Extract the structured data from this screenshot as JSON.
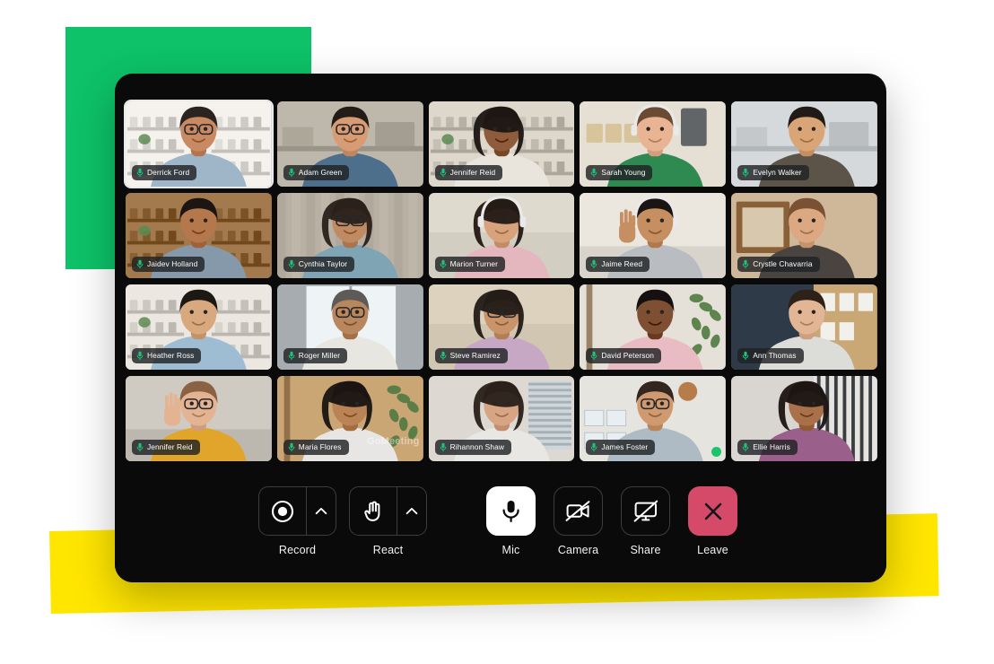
{
  "decor": {
    "green_color": "#0DC268",
    "yellow_color": "#FFE600"
  },
  "window": {
    "background": "#0A0A0A",
    "watermark": "GoMeeting"
  },
  "grid": {
    "columns": 5,
    "rows": 4,
    "participants": [
      {
        "name": "Derrick Ford",
        "mic": "mic-on",
        "active_speaker": true,
        "skin": "#C98A63",
        "shirt": "#9fb6c9",
        "wall": "#efece7",
        "hair": "#2a2320",
        "scene": "shelf"
      },
      {
        "name": "Adam Green",
        "mic": "mic-on",
        "active_speaker": false,
        "skin": "#D79C74",
        "shirt": "#4e6f8c",
        "wall": "#c8c2b6",
        "hair": "#241c17",
        "scene": "dark-shelf"
      },
      {
        "name": "Jennifer Reid",
        "mic": "mic-on",
        "active_speaker": false,
        "skin": "#8E5B3C",
        "shirt": "#e9e4dc",
        "wall": "#d8d2c6",
        "hair": "#1d1714",
        "scene": "books"
      },
      {
        "name": "Sarah Young",
        "mic": "mic-on",
        "active_speaker": false,
        "skin": "#E8B494",
        "shirt": "#2f8a52",
        "wall": "#e2dcd0",
        "hair": "#6b4a32",
        "scene": "kitchen"
      },
      {
        "name": "Evelyn Walker",
        "mic": "mic-on",
        "active_speaker": false,
        "skin": "#D9A577",
        "shirt": "#5c5349",
        "wall": "#dfe3e6",
        "hair": "#211a16",
        "scene": "office"
      },
      {
        "name": "Jaidev Holland",
        "mic": "mic-on",
        "active_speaker": false,
        "skin": "#B4784C",
        "shirt": "#8699ab",
        "wall": "#9c7448",
        "hair": "#1c1512",
        "scene": "bookcase"
      },
      {
        "name": "Cynthia Taylor",
        "mic": "mic-on",
        "active_speaker": false,
        "skin": "#C08A63",
        "shirt": "#7fa5b5",
        "wall": "#b9b0a4",
        "hair": "#2c211b",
        "scene": "curtain"
      },
      {
        "name": "Marion Turner",
        "mic": "mic-on",
        "active_speaker": false,
        "skin": "#D8A27C",
        "shirt": "#e3b7bd",
        "wall": "#dedace",
        "hair": "#241b16",
        "scene": "plain"
      },
      {
        "name": "Jaime Reed",
        "mic": "mic-on",
        "active_speaker": false,
        "skin": "#C68F62",
        "shirt": "#b9bcc0",
        "wall": "#e6e2da",
        "hair": "#1a1512",
        "scene": "wave"
      },
      {
        "name": "Crystle Chavarria",
        "mic": "mic-on",
        "active_speaker": false,
        "skin": "#DCA882",
        "shirt": "#4a4440",
        "wall": "#cfb79a",
        "hair": "#7a5233",
        "scene": "mirror"
      },
      {
        "name": "Heather Ross",
        "mic": "mic-on",
        "active_speaker": false,
        "skin": "#D8A87F",
        "shirt": "#9fbdd2",
        "wall": "#e6e2db",
        "hair": "#1e1814",
        "scene": "shelf"
      },
      {
        "name": "Roger Miller",
        "mic": "mic-on",
        "active_speaker": false,
        "skin": "#B9875E",
        "shirt": "#e8e6e1",
        "wall": "#bcc2c6",
        "hair": "#5d5a58",
        "scene": "window"
      },
      {
        "name": "Steve Ramirez",
        "mic": "mic-on",
        "active_speaker": false,
        "skin": "#C99469",
        "shirt": "#c7a8c4",
        "wall": "#ddd2bd",
        "hair": "#241c17",
        "scene": "plain"
      },
      {
        "name": "David Peterson",
        "mic": "mic-on",
        "active_speaker": false,
        "skin": "#7E4F32",
        "shirt": "#e9bcc4",
        "wall": "#e2ded5",
        "hair": "#161110",
        "scene": "plant"
      },
      {
        "name": "Ann Thomas",
        "mic": "mic-on",
        "active_speaker": false,
        "skin": "#E2B595",
        "shirt": "#dcdcd8",
        "wall": "#b6a488",
        "hair": "#2e2118",
        "scene": "notes"
      },
      {
        "name": "Jennifer Reid",
        "mic": "mic-on",
        "active_speaker": false,
        "skin": "#E3B392",
        "shirt": "#e0a52a",
        "wall": "#cbc6bd",
        "hair": "#8a6243",
        "scene": "wave"
      },
      {
        "name": "Maria Flores",
        "mic": "mic-on",
        "active_speaker": false,
        "skin": "#B98356",
        "shirt": "#e7e6e4",
        "wall": "#c7a371",
        "hair": "#1b1513",
        "scene": "plants",
        "watermark": true
      },
      {
        "name": "Rihannon Shaw",
        "mic": "mic-on",
        "active_speaker": false,
        "skin": "#D7A583",
        "shirt": "#e9e7e3",
        "wall": "#ddd9d2",
        "hair": "#2b211a",
        "scene": "blinds"
      },
      {
        "name": "James Foster",
        "mic": "mic-on",
        "active_speaker": false,
        "skin": "#D09A71",
        "shirt": "#aebbc4",
        "wall": "#e4e2dc",
        "hair": "#32261e",
        "scene": "board",
        "status_dot": true
      },
      {
        "name": "Ellie Harris",
        "mic": "mic-on",
        "active_speaker": false,
        "skin": "#A8714A",
        "shirt": "#9b5f8c",
        "wall": "#d9d6d1",
        "hair": "#1d1613",
        "scene": "stairs"
      }
    ]
  },
  "controls": {
    "items": [
      {
        "id": "record",
        "label": "Record",
        "icon": "record-icon",
        "style": "split",
        "has_caret": true,
        "state": "off"
      },
      {
        "id": "react",
        "label": "React",
        "icon": "hand-icon",
        "style": "split",
        "has_caret": true,
        "state": "off"
      },
      {
        "id": "mic",
        "label": "Mic",
        "icon": "mic-icon",
        "style": "square",
        "has_caret": false,
        "state": "on"
      },
      {
        "id": "camera",
        "label": "Camera",
        "icon": "camera-off-icon",
        "style": "square",
        "has_caret": false,
        "state": "off"
      },
      {
        "id": "share",
        "label": "Share",
        "icon": "screen-share-off-icon",
        "style": "square",
        "has_caret": false,
        "state": "off"
      },
      {
        "id": "leave",
        "label": "Leave",
        "icon": "close-icon",
        "style": "square",
        "has_caret": false,
        "state": "danger"
      }
    ],
    "leave_color": "#D44A68",
    "active_color": "#FFFFFF"
  }
}
